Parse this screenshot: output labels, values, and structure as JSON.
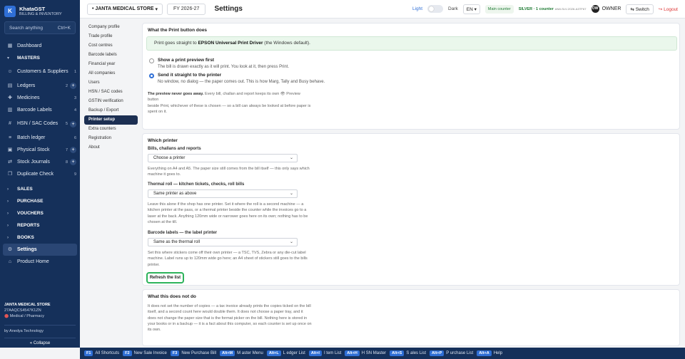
{
  "brand": {
    "logo": "K",
    "name": "KhataGST",
    "sub": "BILLING & INVENTORY"
  },
  "search": {
    "placeholder": "Search anything",
    "shortcut": "Ctrl+K"
  },
  "sidebar": {
    "items": [
      {
        "label": "Dashboard",
        "icon": "grid-icon"
      },
      {
        "label": "MASTERS",
        "section": true
      },
      {
        "label": "Customers & Suppliers",
        "count": "1"
      },
      {
        "label": "Ledgers",
        "count": "2",
        "plus": "+"
      },
      {
        "label": "Medicines",
        "count": "3"
      },
      {
        "label": "Barcode Labels",
        "count": "4"
      },
      {
        "label": "HSN / SAC Codes",
        "count": "5",
        "plus": "+"
      },
      {
        "label": "Batch ledger",
        "count": "6"
      },
      {
        "label": "Physical Stock",
        "count": "7",
        "plus": "+"
      },
      {
        "label": "Stock Journals",
        "count": "8",
        "plus": "+"
      },
      {
        "label": "Duplicate Check",
        "count": "9"
      },
      {
        "label": "SALES"
      },
      {
        "label": "PURCHASE"
      },
      {
        "label": "VOUCHERS"
      },
      {
        "label": "REPORTS"
      },
      {
        "label": "BOOKS"
      },
      {
        "label": "Settings"
      },
      {
        "label": "Product Home"
      }
    ],
    "footer": {
      "shop_name": "JANTA MEDICAL STORE",
      "gstin": "27AAQCS4547K1ZN",
      "type": "Medical / Pharmacy",
      "by": "by Anedya Technology",
      "collapse": "« Collapse"
    }
  },
  "topbar": {
    "shop": "JANTA MEDICAL STORE",
    "fy": "FY 2026-27",
    "title": "Settings",
    "theme_light": "Light",
    "theme_dark": "Dark",
    "lang": "EN",
    "counter": "Main counter",
    "license": "SILVER · 1 counter",
    "license_code": "AN8-SLV-2026-A3TF67",
    "avatar": "OW",
    "owner": "OWNER",
    "switch": "⇆ Switch",
    "logout": "↪ Logout"
  },
  "settings_nav": [
    "Company profile",
    "Trade profile",
    "Cost centres",
    "Barcode labels",
    "Financial year",
    "All companies",
    "Users",
    "HSN / SAC codes",
    "GSTIN verification",
    "Backup / Export",
    "Printer setup",
    "Extra counters",
    "Registration",
    "About"
  ],
  "print_button": {
    "title": "What the Print button does",
    "banner_pre": "Print goes straight to",
    "banner_printer": "EPSON Universal Print Driver",
    "banner_post": "(the Windows default).",
    "option1_title": "Show a print preview first",
    "option1_desc": "The bill is drawn exactly as it will print. You look at it, then press Print.",
    "option2_title": "Send it straight to the printer",
    "option2_desc": "No window, no dialog — the paper comes out. This is how Marg, Tally and Busy behave.",
    "note_bold": "The preview never goes away.",
    "note_line1": "Every bill, challan and report keeps its own 👁 Preview button",
    "note_line2": "beside Print, whichever of these is chosen — so a bill can always be looked at before paper is",
    "note_line3": "spent on it."
  },
  "which_printer": {
    "title": "Which printer",
    "bills_label": "Bills, challans and reports",
    "bills_value": "Choose a printer",
    "bills_note": "Everything on A4 and A5. The paper size still comes from the bill itself — this only says which machine it goes to.",
    "thermal_label": "Thermal roll — kitchen tickets, checks, roll bills",
    "thermal_value": "Same printer as above",
    "thermal_note": "Leave this alone if the shop has one printer. Set it where the roll is a second machine — a kitchen printer at the pass, or a thermal printer beside the counter while the invoices go to a laser at the back. Anything 120mm wide or narrower goes here on its own; nothing has to be chosen at the till.",
    "barcode_label": "Barcode labels — the label printer",
    "barcode_value": "Same as the thermal roll",
    "barcode_note": "Set this where stickers come off their own printer — a TSC, TVS, Zebra or any die-cut label machine. Label runs up to 120mm wide go here; an A4 sheet of stickers still goes to the bills printer.",
    "refresh": "Refresh the list"
  },
  "not_do": {
    "title": "What this does not do",
    "text": "It does not set the number of copies — a tax invoice already prints the copies ticked on the bill itself, and a second count here would double them. It does not choose a paper tray, and it does not change the paper size that is the format picker on the bill. Nothing here is stored in your books or in a backup — it is a fact about this computer, so each counter is set up once on its own."
  },
  "shortcuts": [
    {
      "key": "F1",
      "label": "All Shortcuts"
    },
    {
      "key": "F2",
      "label": "New Sale Invoice"
    },
    {
      "key": "F3",
      "label": "New Purchase Bill"
    },
    {
      "key": "Alt+M",
      "label": "M aster Menu"
    },
    {
      "key": "Alt+L",
      "label": "L edger List"
    },
    {
      "key": "Alt+I",
      "label": "I tem List"
    },
    {
      "key": "Alt+H",
      "label": "H SN Master"
    },
    {
      "key": "Alt+S",
      "label": "S ales List"
    },
    {
      "key": "Alt+P",
      "label": "P urchase List"
    },
    {
      "key": "Alt+A",
      "label": "Help"
    }
  ]
}
